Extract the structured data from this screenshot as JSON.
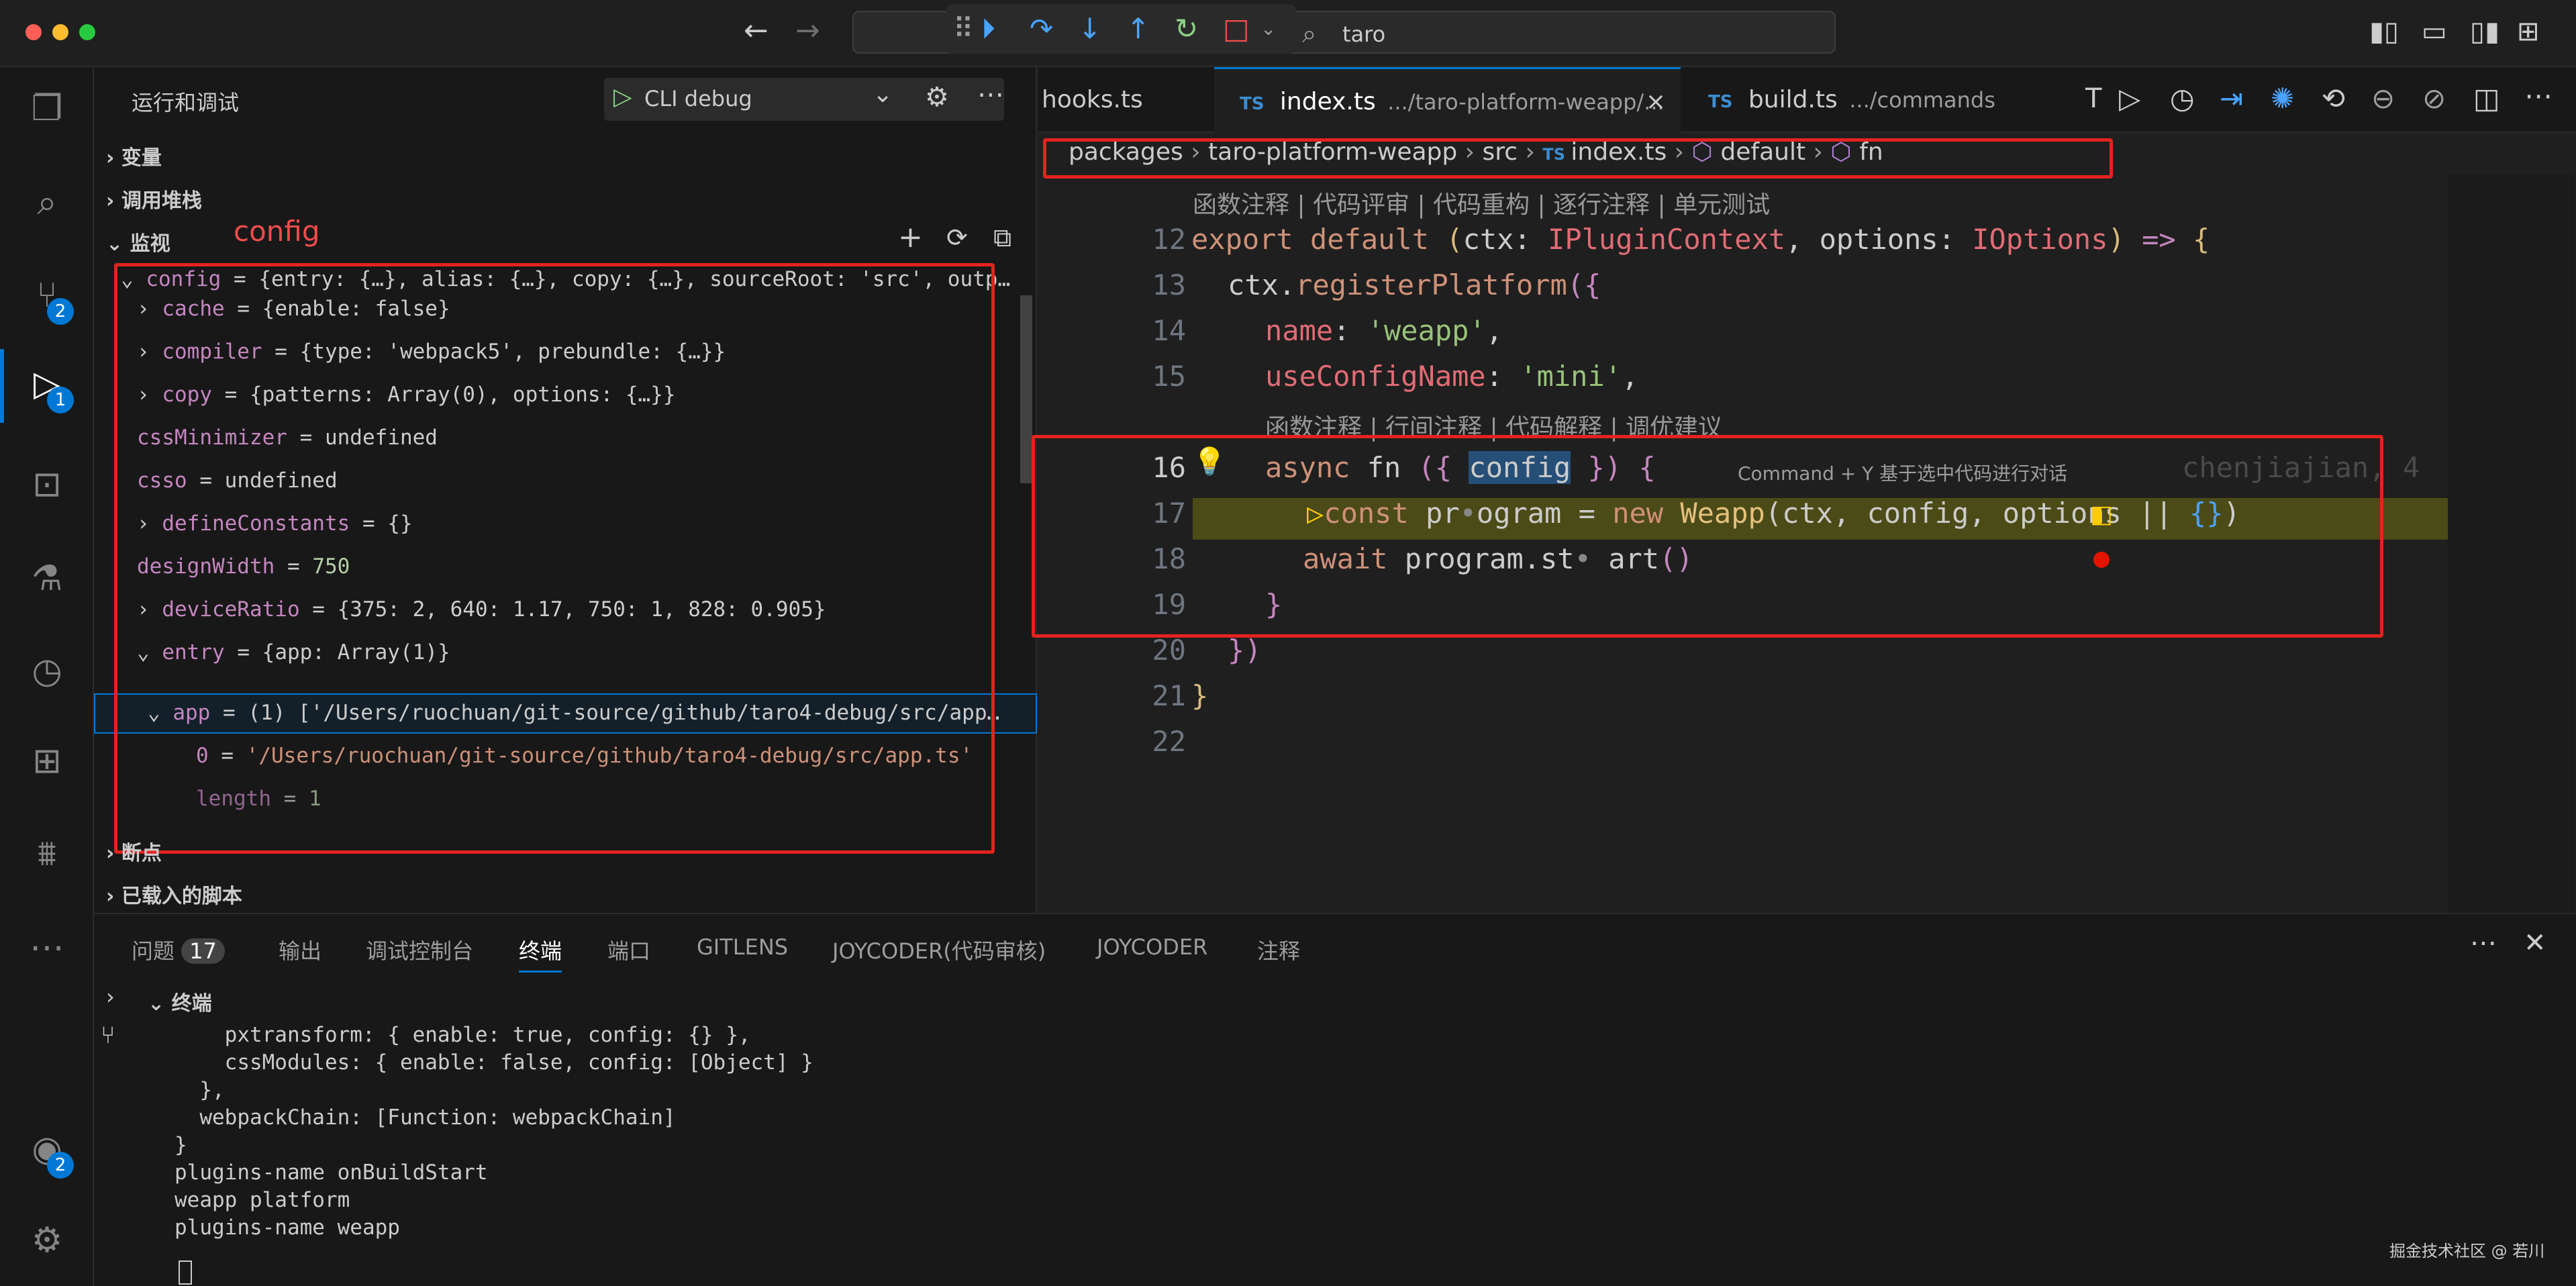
{
  "titlebar": {
    "search_text": "taro"
  },
  "activity": {
    "scm_badge": "2",
    "debug_badge": "1",
    "account_badge": "2"
  },
  "sidebar": {
    "title": "运行和调试",
    "launch_config": "CLI debug",
    "sections": {
      "variables": "变量",
      "call_stack": "调用堆栈",
      "watch": "监视",
      "breakpoints": "断点",
      "loaded_scripts": "已载入的脚本"
    },
    "annotation": "config",
    "watch": {
      "root": {
        "name": "config",
        "value": "{entry: {…}, alias: {…}, copy: {…}, sourceRoot: 'src', outp…"
      },
      "items": [
        {
          "name": "cache",
          "value": "{enable: false}",
          "expandable": true
        },
        {
          "name": "compiler",
          "value": "{type: 'webpack5', prebundle: {…}}",
          "expandable": true
        },
        {
          "name": "copy",
          "value": "{patterns: Array(0), options: {…}}",
          "expandable": true
        },
        {
          "name": "cssMinimizer",
          "value": "undefined",
          "expandable": false
        },
        {
          "name": "csso",
          "value": "undefined",
          "expandable": false
        },
        {
          "name": "defineConstants",
          "value": "{}",
          "expandable": true
        },
        {
          "name": "designWidth",
          "value": "750",
          "expandable": false
        },
        {
          "name": "deviceRatio",
          "value": "{375: 2, 640: 1.17, 750: 1, 828: 0.905}",
          "expandable": true
        },
        {
          "name": "entry",
          "value": "{app: Array(1)}",
          "expandable": true
        }
      ],
      "app_row": {
        "name": "app",
        "value": "(1) ['/Users/ruochuan/git-source/github/taro4-debug/src/app…"
      },
      "app_item": {
        "name": "0",
        "value": "'/Users/ruochuan/git-source/github/taro4-debug/src/app.ts'"
      },
      "length_row": {
        "name": "length",
        "value": "1"
      }
    }
  },
  "editor": {
    "tabs": [
      {
        "label": "hooks.ts",
        "desc": ""
      },
      {
        "label": "index.ts",
        "desc": ".../taro-platform-weapp/..."
      },
      {
        "label": "build.ts",
        "desc": ".../commands"
      }
    ],
    "breadcrumb": [
      "packages",
      "taro-platform-weapp",
      "src",
      "index.ts",
      "default",
      "fn"
    ],
    "lens_top": "函数注释 | 代码评审 | 代码重构 | 逐行注释 | 单元测试",
    "lens_mid": "函数注释 | 行间注释 | 代码解释 | 调优建议",
    "inline_hint": "Command + Y 基于选中代码进行对话",
    "blame": "chenjiajian, 4",
    "line_numbers": [
      "12",
      "13",
      "14",
      "15",
      "16",
      "17",
      "18",
      "19",
      "20",
      "21",
      "22"
    ]
  },
  "panel": {
    "tabs": [
      "问题",
      "输出",
      "调试控制台",
      "终端",
      "端口",
      "GITLENS",
      "JOYCODER(代码审核)",
      "JOYCODER",
      "注释"
    ],
    "problems_count": "17",
    "terminal_title": "终端",
    "terminal_lines": [
      "    pxtransform: { enable: true, config: {} },",
      "    cssModules: { enable: false, config: [Object] }",
      "  },",
      "  webpackChain: [Function: webpackChain]",
      "}",
      "plugins-name onBuildStart",
      "weapp platform",
      "plugins-name weapp"
    ],
    "watermark": "掘金技术社区 @ 若川"
  }
}
